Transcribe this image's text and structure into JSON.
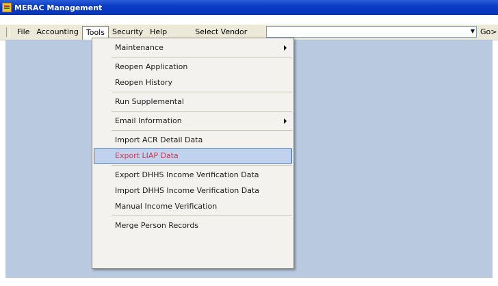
{
  "window": {
    "title": "MERAC Management"
  },
  "menubar": {
    "items": [
      {
        "label": "File"
      },
      {
        "label": "Accounting"
      },
      {
        "label": "Tools"
      },
      {
        "label": "Security"
      },
      {
        "label": "Help"
      }
    ],
    "vendor_label": "Select Vendor",
    "vendor_value": "",
    "go_label": "Go>"
  },
  "tools_menu": {
    "items": [
      {
        "label": "Maintenance",
        "submenu": true
      },
      {
        "label": "Reopen Application"
      },
      {
        "label": "Reopen History"
      },
      {
        "label": "Run Supplemental"
      },
      {
        "label": "Email Information",
        "submenu": true
      },
      {
        "label": "Import ACR Detail Data"
      },
      {
        "label": "Export LIAP Data",
        "selected": true
      },
      {
        "label": "Export DHHS Income Verification Data"
      },
      {
        "label": "Import DHHS Income Verification Data"
      },
      {
        "label": "Manual Income Verification"
      },
      {
        "label": "Merge Person Records"
      }
    ]
  },
  "colors": {
    "titlebar": "#0a3cc7",
    "content_background": "#b9c9e0",
    "menu_background": "#f3f2ee",
    "selected_highlight": "#c1d2ee",
    "selected_text": "#e0304a"
  }
}
